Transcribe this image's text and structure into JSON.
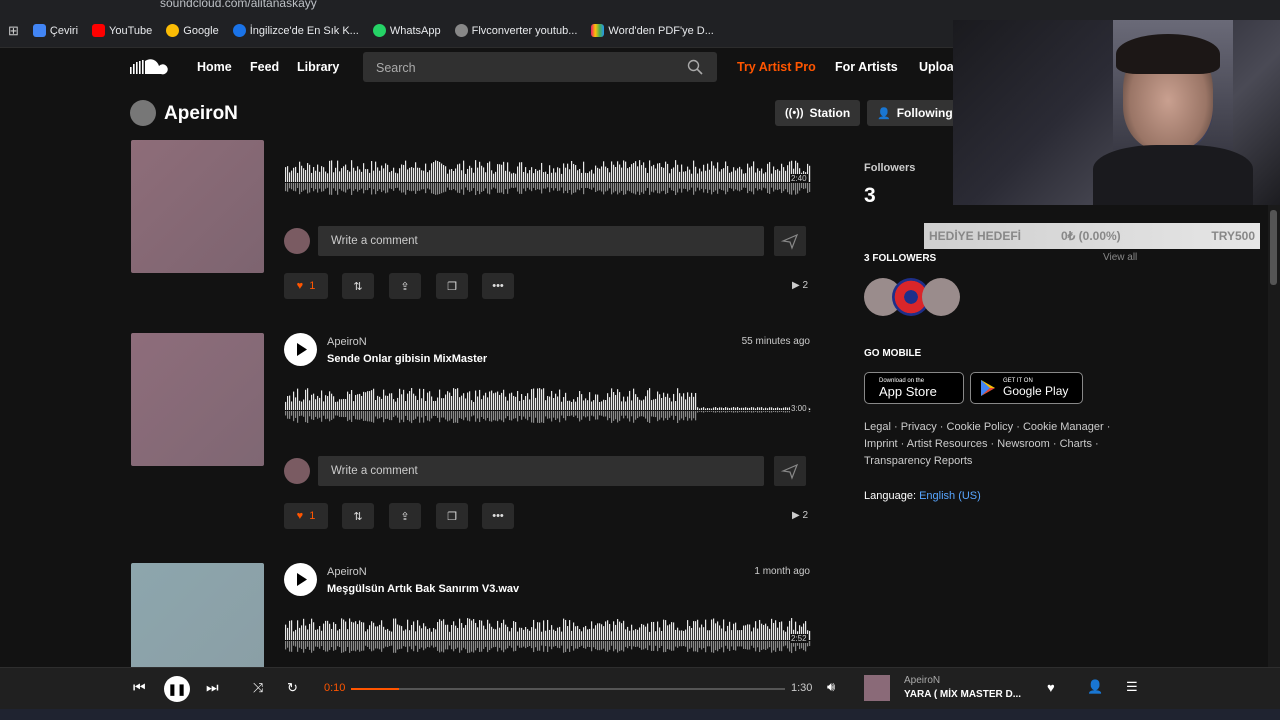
{
  "browser": {
    "url": "soundcloud.com/alitanaskayy",
    "bookmarks": [
      {
        "label": "Çeviri",
        "color": "#4285f4"
      },
      {
        "label": "YouTube",
        "color": "#ff0000"
      },
      {
        "label": "Google",
        "color": "#fbbc05"
      },
      {
        "label": "İngilizce'de En Sık K...",
        "color": "#1a73e8"
      },
      {
        "label": "WhatsApp",
        "color": "#25d366"
      },
      {
        "label": "Flvconverter youtub...",
        "color": "#888888"
      },
      {
        "label": "Word'den PDF'ye D...",
        "color": "#e91e63"
      }
    ]
  },
  "nav": {
    "home": "Home",
    "feed": "Feed",
    "library": "Library",
    "search_placeholder": "Search",
    "try_pro": "Try Artist Pro",
    "for_artists": "For Artists",
    "upload": "Upload"
  },
  "profile": {
    "name": "ApeiroN",
    "station_label": "Station",
    "following_label": "Following"
  },
  "tracks": [
    {
      "artist": "",
      "title": "",
      "ago": "",
      "duration": "2:40",
      "likes": "1",
      "plays": "2",
      "art_color": "#8a6a75",
      "comment_placeholder": "Write a comment"
    },
    {
      "artist": "ApeiroN",
      "title": "Sende Onlar gibisin MixMaster",
      "ago": "55 minutes ago",
      "duration": "3:00",
      "likes": "1",
      "plays": "2",
      "art_color": "#8a6a78",
      "comment_placeholder": "Write a comment"
    },
    {
      "artist": "ApeiroN",
      "title": "Meşgülsün Artık Bak Sanırım V3.wav",
      "ago": "1 month ago",
      "duration": "2:52",
      "art_color": "#8aa0a8"
    }
  ],
  "sidebar": {
    "followers_label": "Followers",
    "followers_count": "3",
    "followers_heading": "3 FOLLOWERS",
    "view_all": "View all",
    "go_mobile": "GO MOBILE",
    "app_store_small": "Download on the",
    "app_store_big": "App Store",
    "google_small": "GET IT ON",
    "google_big": "Google Play",
    "footer_line1": "Legal · Privacy · Cookie Policy · Cookie Manager ·",
    "footer_line2": "Imprint · Artist Resources · Newsroom · Charts ·",
    "footer_line3": "Transparency Reports",
    "language_label": "Language:",
    "language_value": "English (US)"
  },
  "overlay": {
    "goal_label": "HEDİYE HEDEFİ",
    "goal_progress": "0₺ (0.00%)",
    "goal_target": "TRY500"
  },
  "player": {
    "elapsed": "0:10",
    "total": "1:30",
    "progress_fraction": 0.11,
    "artist": "ApeiroN",
    "title": "YARA ( MİX MASTER D..."
  },
  "colors": {
    "accent": "#ff5500",
    "bg": "#121212"
  }
}
